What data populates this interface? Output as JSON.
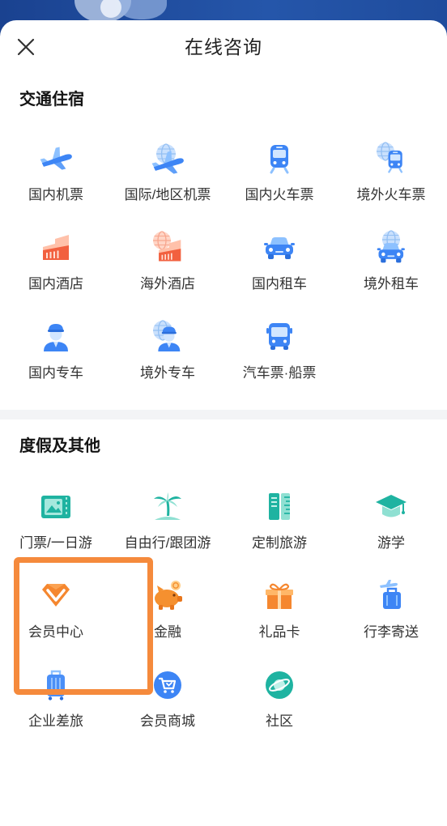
{
  "header": {
    "title": "在线咨询",
    "close_icon": "close-icon"
  },
  "colors": {
    "backdrop": "#1d4795",
    "highlight": "#f58a3c",
    "divider": "#f3f4f6",
    "accent_blue": "#3d85f5",
    "accent_teal": "#1fb3a1",
    "accent_orange": "#f5872f"
  },
  "sections": [
    {
      "title": "交通住宿",
      "items": [
        {
          "label": "国内机票",
          "icon": "airplane-icon"
        },
        {
          "label": "国际/地区机票",
          "icon": "globe-airplane-icon"
        },
        {
          "label": "国内火车票",
          "icon": "train-icon"
        },
        {
          "label": "境外火车票",
          "icon": "globe-train-icon"
        },
        {
          "label": "国内酒店",
          "icon": "hotel-icon"
        },
        {
          "label": "海外酒店",
          "icon": "globe-hotel-icon"
        },
        {
          "label": "国内租车",
          "icon": "car-icon"
        },
        {
          "label": "境外租车",
          "icon": "globe-car-icon"
        },
        {
          "label": "国内专车",
          "icon": "chauffeur-icon"
        },
        {
          "label": "境外专车",
          "icon": "globe-chauffeur-icon"
        },
        {
          "label": "汽车票·船票",
          "icon": "bus-icon"
        }
      ]
    },
    {
      "title": "度假及其他",
      "items": [
        {
          "label": "门票/一日游",
          "icon": "ticket-icon"
        },
        {
          "label": "自由行/跟团游",
          "icon": "palm-tree-icon"
        },
        {
          "label": "定制旅游",
          "icon": "custom-tour-icon"
        },
        {
          "label": "游学",
          "icon": "graduation-cap-icon"
        },
        {
          "label": "会员中心",
          "icon": "vip-diamond-icon",
          "highlighted": true
        },
        {
          "label": "金融",
          "icon": "piggy-bank-icon"
        },
        {
          "label": "礼品卡",
          "icon": "gift-box-icon"
        },
        {
          "label": "行李寄送",
          "icon": "luggage-delivery-icon"
        },
        {
          "label": "企业差旅",
          "icon": "business-suitcase-icon"
        },
        {
          "label": "会员商城",
          "icon": "shopping-cart-icon"
        },
        {
          "label": "社区",
          "icon": "community-planet-icon"
        }
      ]
    }
  ]
}
